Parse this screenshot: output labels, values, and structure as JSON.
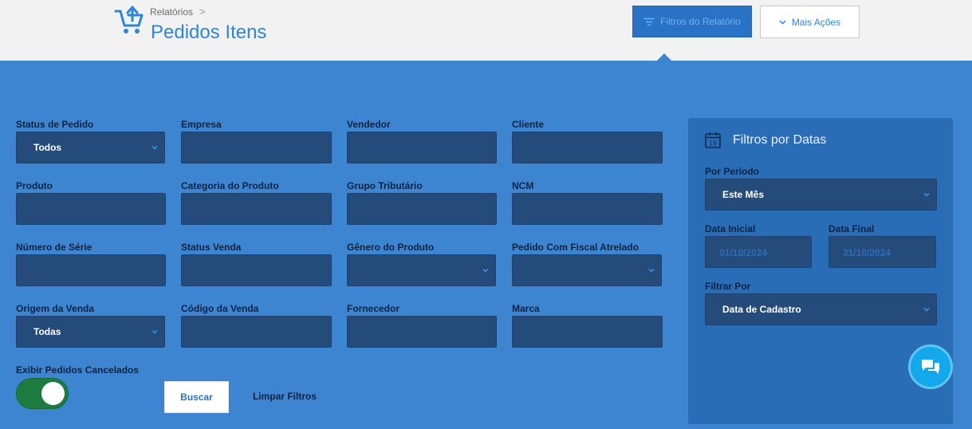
{
  "header": {
    "breadcrumb": "Relatórios",
    "breadcrumb_separator": ">",
    "title": "Pedidos Itens",
    "filters_button": "Filtros do Relatório",
    "more_actions_button": "Mais Ações"
  },
  "filters": {
    "status_pedido": {
      "label": "Status de Pedido",
      "value": "Todos"
    },
    "empresa": {
      "label": "Empresa",
      "value": ""
    },
    "vendedor": {
      "label": "Vendedor",
      "value": ""
    },
    "cliente": {
      "label": "Cliente",
      "value": ""
    },
    "produto": {
      "label": "Produto",
      "value": ""
    },
    "categoria_produto": {
      "label": "Categoria do Produto",
      "value": ""
    },
    "grupo_tributario": {
      "label": "Grupo Tributário",
      "value": ""
    },
    "ncm": {
      "label": "NCM",
      "value": ""
    },
    "numero_serie": {
      "label": "Número de Série",
      "value": ""
    },
    "status_venda": {
      "label": "Status Venda",
      "value": ""
    },
    "genero_produto": {
      "label": "Gênero do Produto",
      "value": ""
    },
    "pedido_fiscal": {
      "label": "Pedido Com Fiscal Atrelado",
      "value": ""
    },
    "origem_venda": {
      "label": "Origem da Venda",
      "value": "Todas"
    },
    "codigo_venda": {
      "label": "Código da Venda",
      "value": ""
    },
    "fornecedor": {
      "label": "Fornecedor",
      "value": ""
    },
    "marca": {
      "label": "Marca",
      "value": ""
    },
    "exibir_cancelados": {
      "label": "Exibir Pedidos Cancelados",
      "on": true
    }
  },
  "actions": {
    "buscar": "Buscar",
    "limpar": "Limpar Filtros"
  },
  "date_filters": {
    "title": "Filtros por Datas",
    "periodo": {
      "label": "Por Período",
      "value": "Este Mês"
    },
    "data_inicial": {
      "label": "Data Inicial",
      "placeholder": "01/10/2024"
    },
    "data_final": {
      "label": "Data Final",
      "placeholder": "31/10/2024"
    },
    "filtrar_por": {
      "label": "Filtrar Por",
      "value": "Data de Cadastro"
    }
  },
  "colors": {
    "accent": "#2f86d6",
    "panel": "#3d85d1",
    "field": "#244b7a",
    "toggle_on": "#1e7b3f",
    "chat": "#13a8ec"
  },
  "icons": [
    "cart-upload-icon",
    "filter-lines-icon",
    "chevron-down-icon",
    "calendar-icon",
    "chat-bubbles-icon"
  ]
}
